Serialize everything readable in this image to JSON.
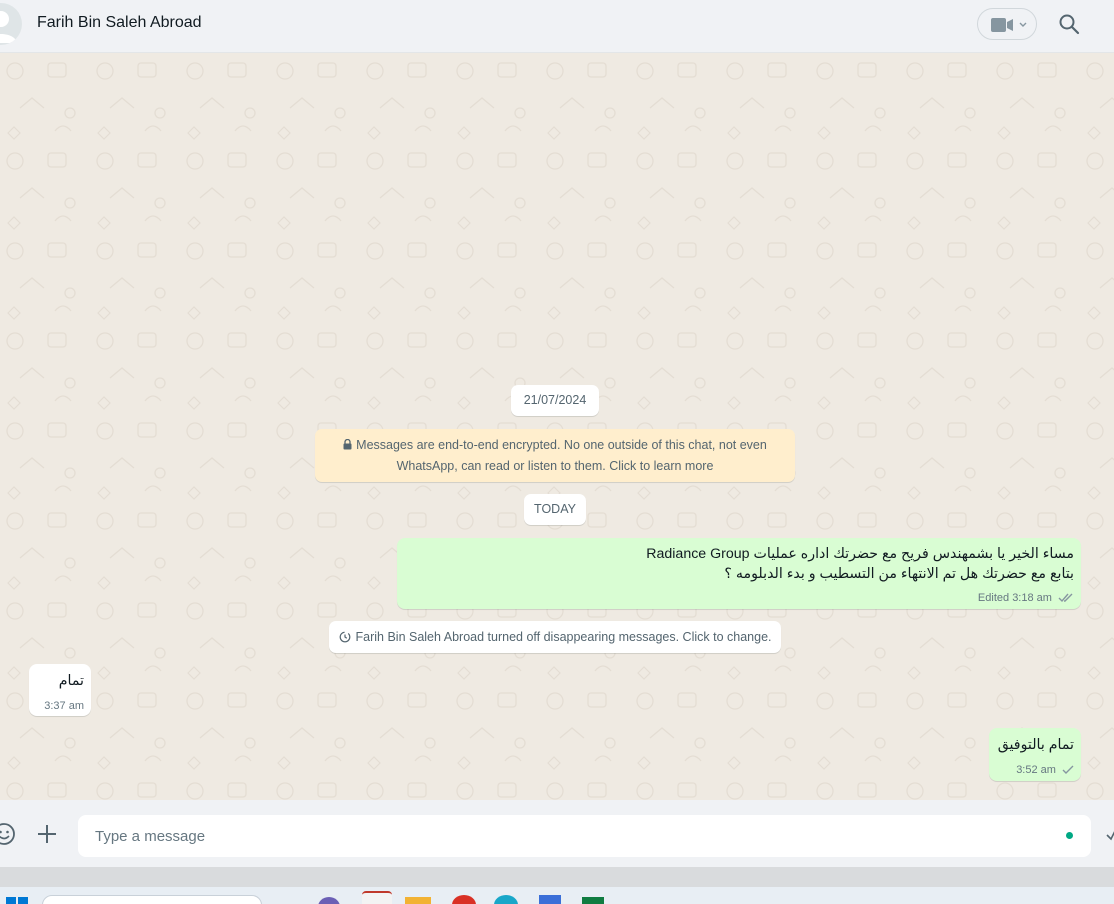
{
  "header": {
    "contact_name": "Farih Bin Saleh Abroad"
  },
  "chat": {
    "date_chip": "21/07/2024",
    "encryption_notice_line1": "Messages are end-to-end encrypted. No one outside of this chat, not even",
    "encryption_notice_line2": "WhatsApp, can read or listen to them. Click to learn more",
    "today_chip": "TODAY",
    "messages": [
      {
        "direction": "outgoing",
        "line1": "مساء الخير يا بشمهندس فريح مع  حضرتك اداره عمليات Radiance Group",
        "line2": "بتابع مع حضرتك هل تم الانتهاء من التسطيب و بدء الدبلومه ؟",
        "edited_label": "Edited",
        "time": "3:18 am",
        "status": "read-double-tick"
      },
      {
        "direction": "incoming",
        "text": "تمام",
        "time": "3:37 am"
      },
      {
        "direction": "outgoing",
        "text": "تمام بالتوفيق",
        "time": "3:52 am",
        "status": "sent-single-tick"
      }
    ],
    "system_notice": "Farih Bin Saleh Abroad turned off disappearing messages. Click to change."
  },
  "composer": {
    "placeholder": "Type a message",
    "value": ""
  },
  "colors": {
    "outgoing_bubble": "#d9fdd3",
    "incoming_bubble": "#ffffff",
    "chat_background": "#efeae2",
    "encryption_notice_bg": "#ffeecd",
    "accent": "#00a884"
  },
  "icons": [
    "default-avatar-icon",
    "video-call-icon",
    "chevron-down-icon",
    "search-icon",
    "lock-icon",
    "timer-icon",
    "double-check-icon",
    "single-check-icon",
    "emoji-icon",
    "plus-icon",
    "send-icon"
  ]
}
